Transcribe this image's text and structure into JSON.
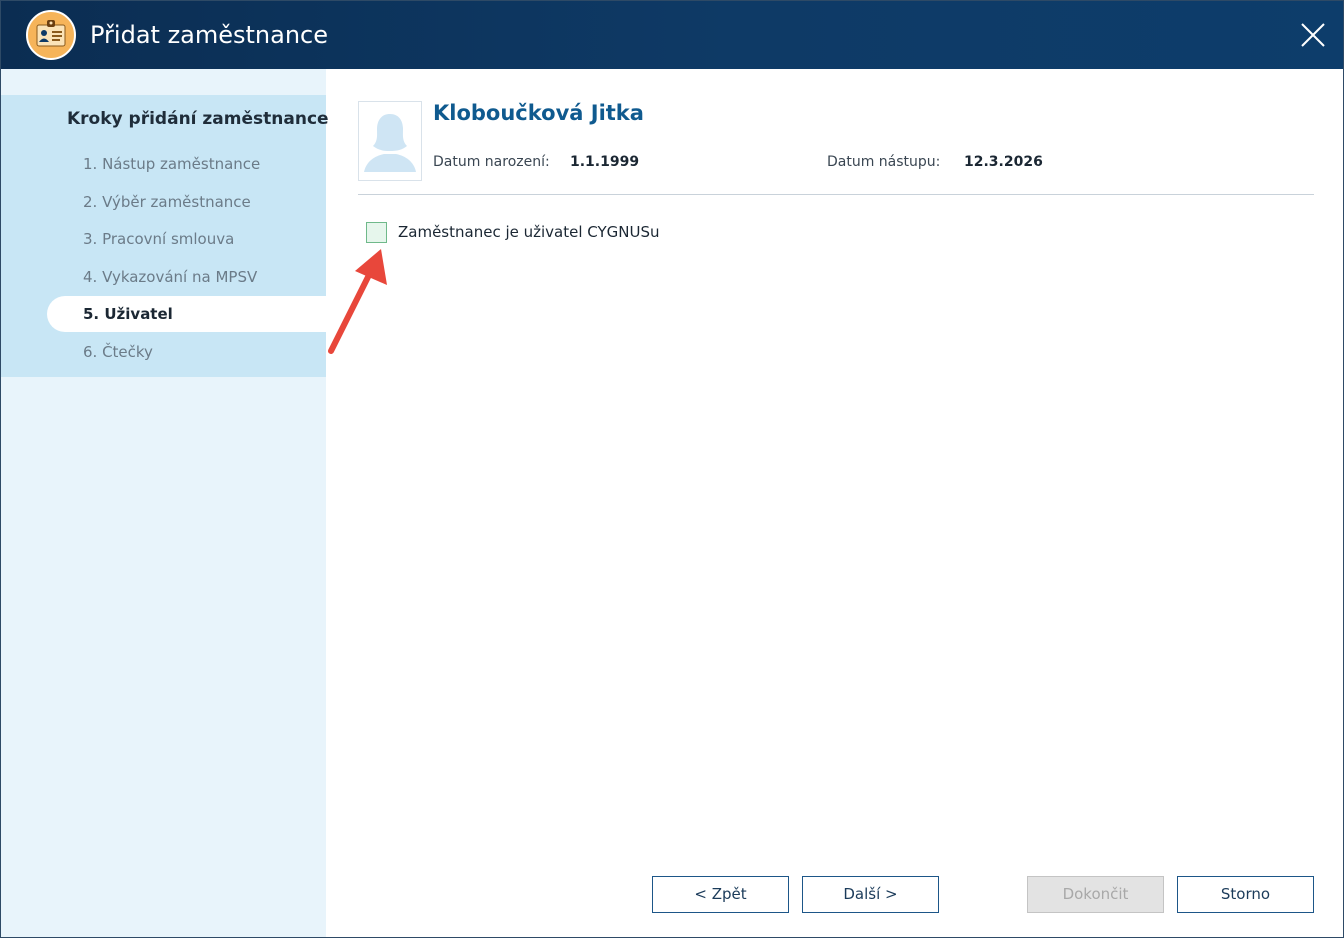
{
  "window": {
    "title": "Přidat zaměstnance"
  },
  "sidebar": {
    "heading": "Kroky přidání zaměstnance",
    "steps": [
      {
        "label": "1. Nástup zaměstnance"
      },
      {
        "label": "2. Výběr zaměstnance"
      },
      {
        "label": "3. Pracovní smlouva"
      },
      {
        "label": "4. Vykazování na MPSV"
      },
      {
        "label": "5. Uživatel"
      },
      {
        "label": "6. Čtečky"
      }
    ],
    "active_step": "5. Uživatel"
  },
  "employee": {
    "name": "Kloboučková Jitka",
    "birth_date_label": "Datum narození:",
    "birth_date": "1.1.1999",
    "start_date_label": "Datum nástupu:",
    "start_date": "12.3.2026"
  },
  "form": {
    "is_user_checkbox_label": "Zaměstnanec je uživatel CYGNUSu",
    "is_user_checked": false
  },
  "buttons": {
    "back": "< Zpět",
    "next": "Další >",
    "finish": "Dokončit",
    "cancel": "Storno"
  },
  "colors": {
    "titlebar": "#0e3a66",
    "sidebar": "#e8f4fb",
    "steps_panel": "#c8e6f5",
    "name_accent": "#0f5a8f",
    "annotation_arrow": "#e8473b"
  }
}
